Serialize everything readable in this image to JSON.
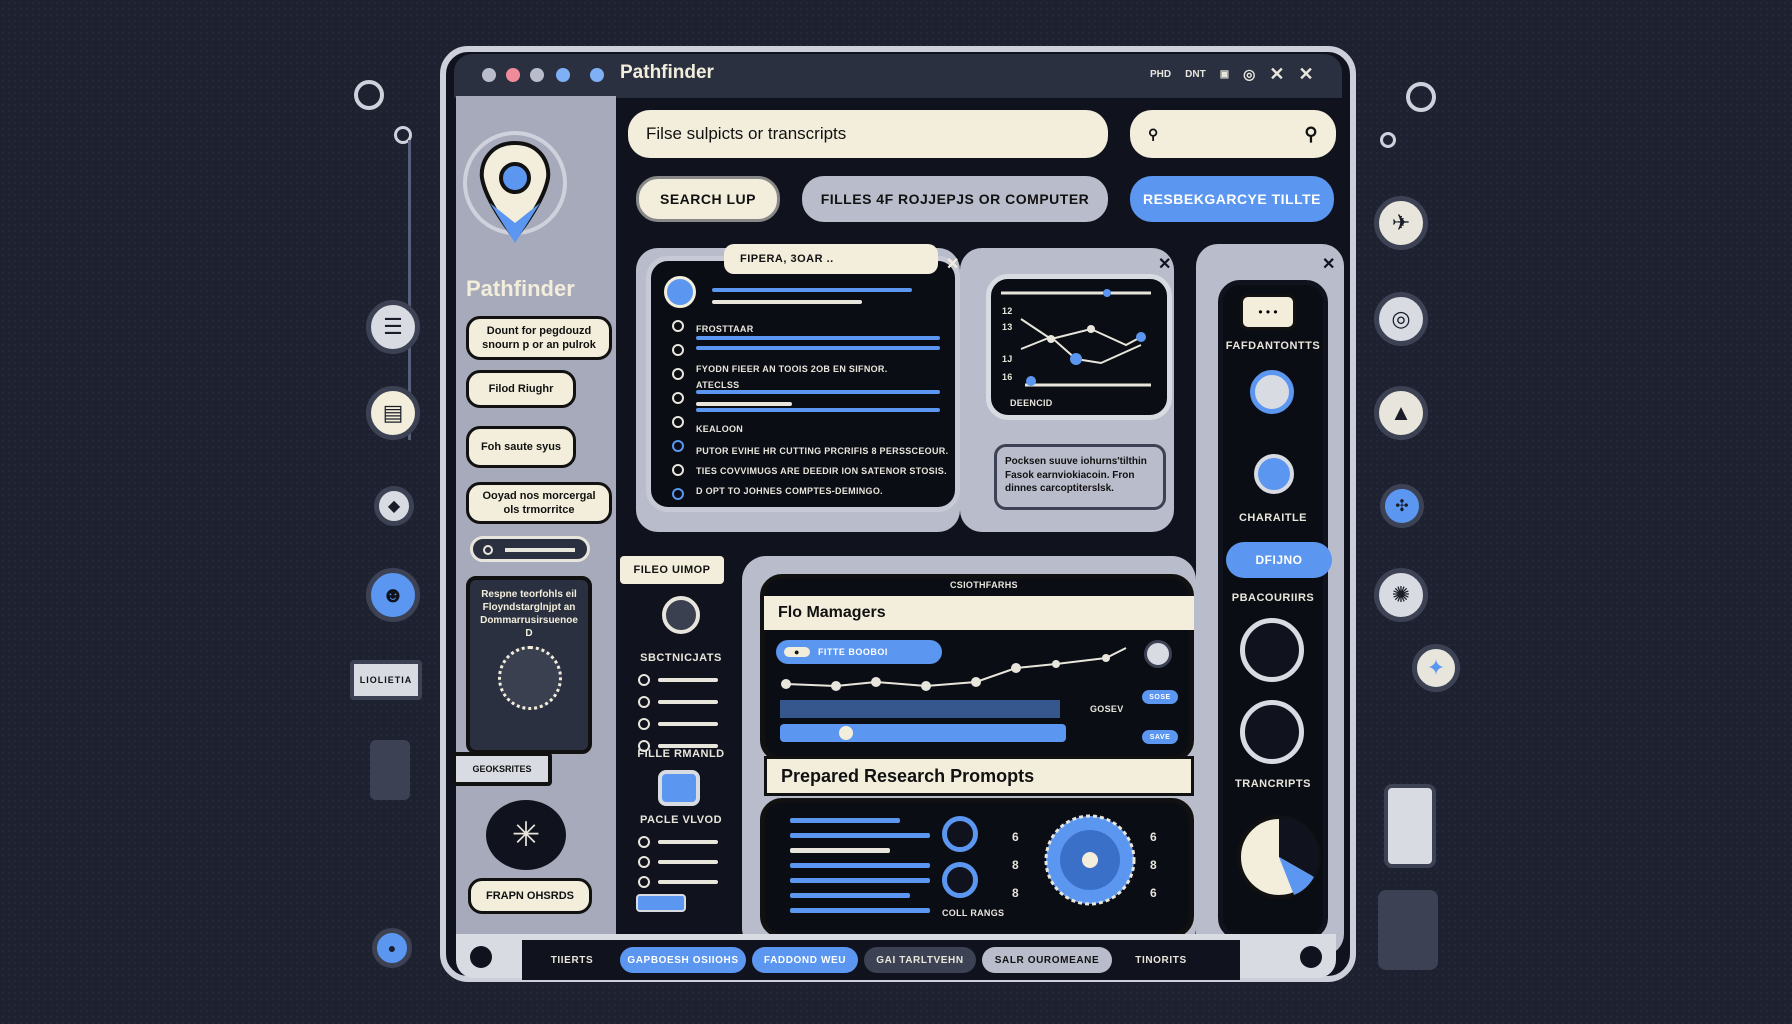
{
  "app": {
    "title": "Pathfinder",
    "titlebar_right": [
      "PHD",
      "DNT"
    ],
    "logo_name": "Pathfinder"
  },
  "search": {
    "placeholder": "Filse sulpicts or transcripts"
  },
  "buttons": {
    "search": "SEARCH LUP",
    "files": "FILLES 4F ROJJEPJS OR COMPUTER",
    "research": "RESBEKGARCYE TILLTE"
  },
  "sidebar": {
    "bubbles": [
      "Dount for pegdouzd snourn p or an pulrok",
      "Filod Riughr",
      "Foh saute syus",
      "Ooyad nos morcergal ols trmorritce"
    ],
    "card_text": "Respne teorfohls eil Floyndstarglnjpt an Dommarrusirsuenoe D",
    "label_box": "GEOKSRITES",
    "bottom": "FRAPN OHSRDS"
  },
  "panel1": {
    "tab": "FIPERA, 3OAR ..",
    "rows": [
      "FROSTTAAR",
      "FYODN FIEER AN TOOIS 2OB EN SIFNOR.",
      "ATECLSS",
      "KEALOON",
      "PUTOR EVIHE HR CUTTING PRCRIFIS 8 PERSSCEOUR.",
      "TIES COVVIMUGS ARE DEEDIR ION SATENOR STOSIS.",
      "D OPT TO JOHNES COMPTES-DEMINGO."
    ]
  },
  "chart_small": {
    "ticks": [
      "12",
      "13",
      "1J",
      "16"
    ],
    "footer": "DEENCID"
  },
  "note": "Pocksen suuve iohurns'tilthin Fasok earnviokiacoin. Fron dinnes carcoptiterslsk.",
  "right_col": {
    "labels": [
      "FAFDANTONTTS",
      "CHARAITLE",
      "PBACOURIIRS",
      "TRANCRIPTS"
    ],
    "button": "DFIJNO"
  },
  "left_mini": {
    "header": "FILEO UIMOP",
    "labels": [
      "SBCTNICJATS",
      "FILLE RMANLD",
      "PACLE VLVOD"
    ]
  },
  "file_managers": {
    "header": "CSIOTHFARHS",
    "title": "Flo Mamagers",
    "pill": "FITTE BOOBOI",
    "value_label": "GOSEV",
    "side_buttons": [
      "SOSE",
      "SAVE"
    ]
  },
  "prompts": {
    "title": "Prepared Research Promopts",
    "caption": "COLL RANGS",
    "gauge_ticks": [
      "6",
      "8",
      "8",
      "6",
      "8",
      "6"
    ]
  },
  "bottom_tabs": [
    "TIIERTS",
    "GAPBOESH OSIIOHS",
    "FADDOND WEU",
    "GAI TARLTVEHN",
    "SALR OUROMEANE",
    "TINORITS"
  ],
  "left_badge": "LIOLIETIA",
  "colors": {
    "accent": "#5b96f0",
    "cream": "#f3eedb",
    "frame": "#10131d",
    "grey": "#b9bdcb"
  }
}
